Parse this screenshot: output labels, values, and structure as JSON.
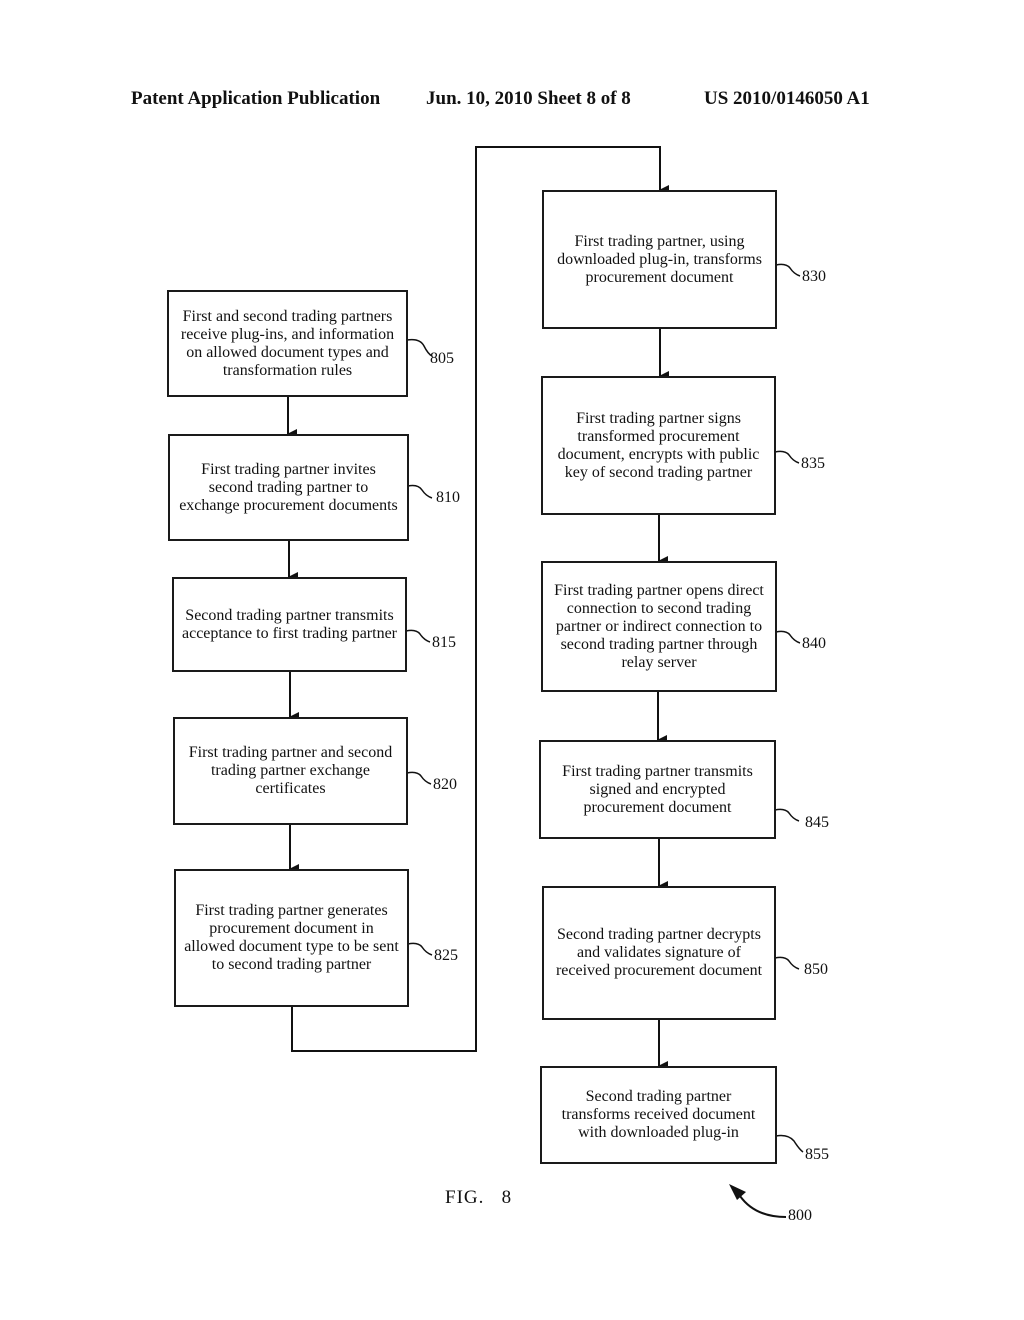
{
  "header": {
    "left": "Patent Application Publication",
    "middle": "Jun. 10, 2010  Sheet 8 of 8",
    "right": "US 2010/0146050 A1"
  },
  "figure": {
    "label": "FIG.   8",
    "ref": "800"
  },
  "steps": [
    {
      "ref": "805",
      "text": "First and second trading partners receive plug-ins, and information on allowed document types and transformation rules"
    },
    {
      "ref": "810",
      "text": "First trading partner invites second trading partner to exchange procurement documents"
    },
    {
      "ref": "815",
      "text": "Second trading partner transmits acceptance to first trading partner"
    },
    {
      "ref": "820",
      "text": "First trading partner and second trading partner exchange certificates"
    },
    {
      "ref": "825",
      "text": "First trading partner generates procurement document in allowed document type to be sent to second trading partner"
    },
    {
      "ref": "830",
      "text": "First trading partner, using downloaded plug-in, transforms procurement document"
    },
    {
      "ref": "835",
      "text": "First trading partner signs transformed procurement document, encrypts with public key of second trading partner"
    },
    {
      "ref": "840",
      "text": "First trading partner opens direct connection to second trading partner or indirect connection to second trading partner through relay server"
    },
    {
      "ref": "845",
      "text": "First trading partner transmits signed and encrypted procurement document"
    },
    {
      "ref": "850",
      "text": "Second trading partner decrypts and validates signature of received procurement document"
    },
    {
      "ref": "855",
      "text": "Second trading partner transforms received document with downloaded plug-in"
    }
  ]
}
